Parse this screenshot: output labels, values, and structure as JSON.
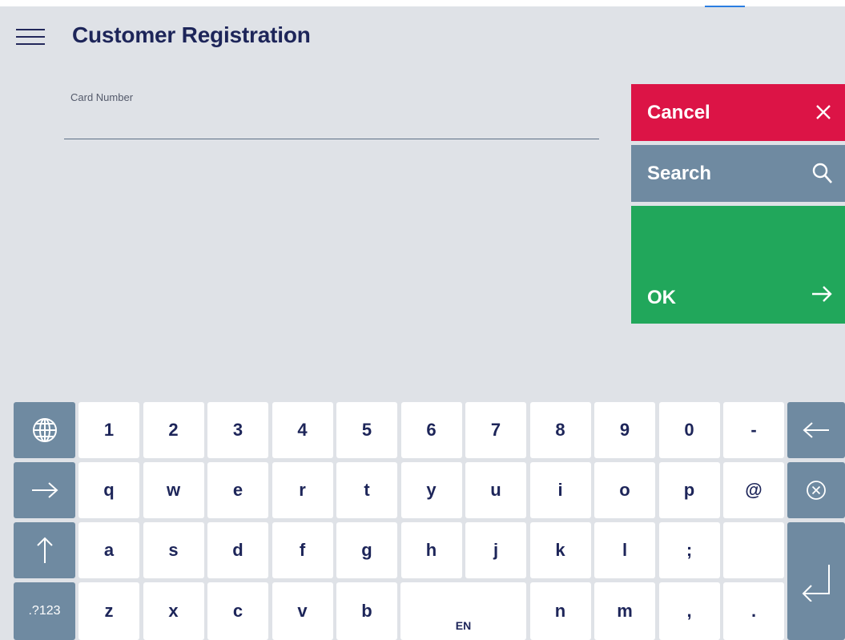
{
  "header": {
    "menu_icon": "hamburger-menu-icon",
    "title": "Customer Registration"
  },
  "form": {
    "card_number_label": "Card Number",
    "card_number_value": ""
  },
  "actions": {
    "cancel_label": "Cancel",
    "cancel_icon": "close-icon",
    "search_label": "Search",
    "search_icon": "search-icon",
    "ok_label": "OK",
    "ok_icon": "arrow-right-icon"
  },
  "colors": {
    "cancel": "#dc1446",
    "search": "#6f8aa1",
    "ok": "#21a75b",
    "title": "#1d2559",
    "background": "#dfe2e7"
  },
  "keyboard": {
    "row1": [
      "1",
      "2",
      "3",
      "4",
      "5",
      "6",
      "7",
      "8",
      "9",
      "0",
      "-"
    ],
    "row2": [
      "q",
      "w",
      "e",
      "r",
      "t",
      "y",
      "u",
      "i",
      "o",
      "p",
      "@"
    ],
    "row3": [
      "a",
      "s",
      "d",
      "f",
      "g",
      "h",
      "j",
      "k",
      "l",
      ";",
      ""
    ],
    "row4_left": [
      "z",
      "x",
      "c",
      "v",
      "b"
    ],
    "row4_right": [
      "n",
      "m",
      ",",
      "."
    ],
    "space_label": "EN",
    "symbols_label": ".?123",
    "function_icons": [
      "globe-icon",
      "tab-arrow-icon",
      "shift-arrow-icon",
      "backspace-arrow-icon",
      "clear-x-icon",
      "enter-icon"
    ]
  }
}
